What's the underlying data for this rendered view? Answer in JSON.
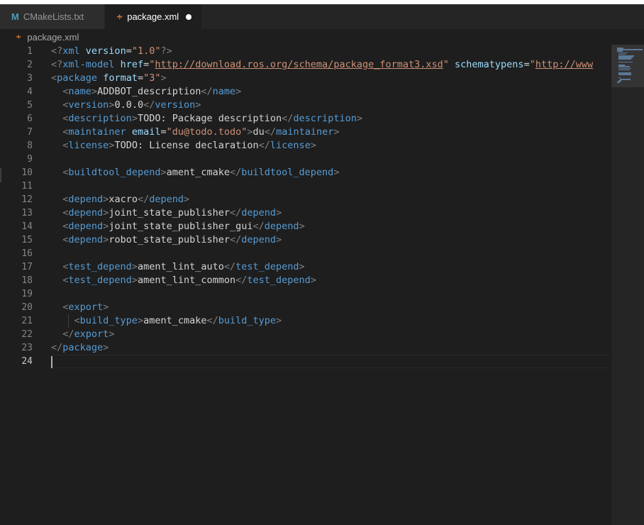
{
  "tabs": [
    {
      "label": "CMakeLists.txt",
      "icon": "cmake-m-icon",
      "active": false
    },
    {
      "label": "package.xml",
      "icon": "rss-icon",
      "active": true,
      "dirty": true
    }
  ],
  "breadcrumb": {
    "file": "package.xml",
    "icon": "rss-icon"
  },
  "editor": {
    "current_line": 24,
    "line_numbers": [
      "1",
      "2",
      "3",
      "4",
      "5",
      "6",
      "7",
      "8",
      "9",
      "10",
      "11",
      "12",
      "13",
      "14",
      "15",
      "16",
      "17",
      "18",
      "19",
      "20",
      "21",
      "22",
      "23",
      "24"
    ],
    "lines": [
      "<?xml version=\"1.0\"?>",
      "<?xml-model href=\"http://download.ros.org/schema/package_format3.xsd\" schematypens=\"http://www",
      "<package format=\"3\">",
      "  <name>ADDBOT_description</name>",
      "  <version>0.0.0</version>",
      "  <description>TODO: Package description</description>",
      "  <maintainer email=\"du@todo.todo\">du</maintainer>",
      "  <license>TODO: License declaration</license>",
      "",
      "  <buildtool_depend>ament_cmake</buildtool_depend>",
      "",
      "  <depend>xacro</depend>",
      "  <depend>joint_state_publisher</depend>",
      "  <depend>joint_state_publisher_gui</depend>",
      "  <depend>robot_state_publisher</depend>",
      "",
      "  <test_depend>ament_lint_auto</test_depend>",
      "  <test_depend>ament_lint_common</test_depend>",
      "",
      "  <export>",
      "    <build_type>ament_cmake</build_type>",
      "  </export>",
      "</package>",
      ""
    ]
  },
  "colors": {
    "background": "#1e1e1e",
    "tag": "#569cd6",
    "attribute": "#9cdcfe",
    "string": "#ce9178",
    "punctuation": "#808080",
    "text": "#d4d4d4",
    "line_number": "#858585",
    "modified_dot": "#ffffff"
  }
}
